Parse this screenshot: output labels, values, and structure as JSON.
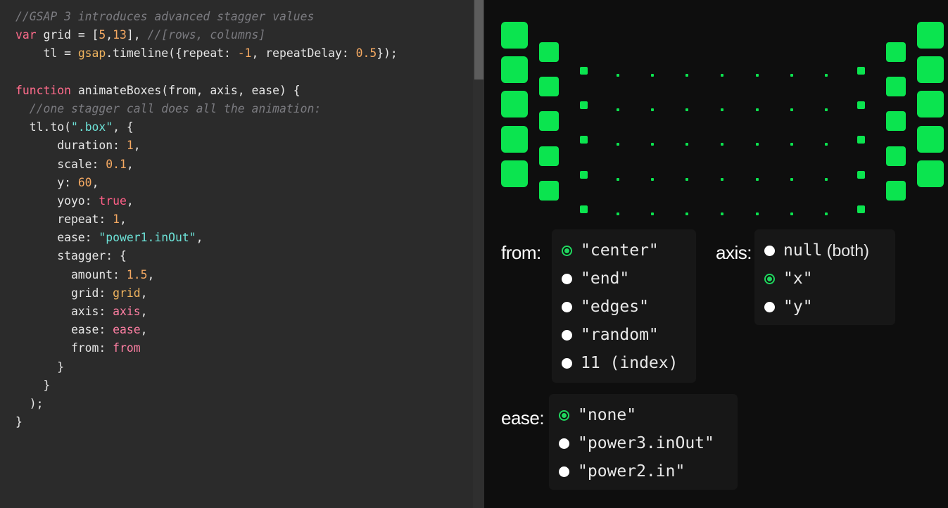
{
  "colors": {
    "editor_bg": "#2b2b2b",
    "demo_bg": "#0e0e0e",
    "box": "#0be44f",
    "radio_selected": "#20d85f"
  },
  "code": {
    "lines": [
      [
        {
          "t": "//GSAP 3 introduces advanced stagger values",
          "c": "cmt"
        }
      ],
      [
        {
          "t": "var",
          "c": "kw"
        },
        {
          "t": " grid = [",
          "c": "plain"
        },
        {
          "t": "5",
          "c": "num"
        },
        {
          "t": ",",
          "c": "plain"
        },
        {
          "t": "13",
          "c": "num"
        },
        {
          "t": "], ",
          "c": "plain"
        },
        {
          "t": "//[rows, columns]",
          "c": "cmt"
        }
      ],
      [
        {
          "t": "    tl = ",
          "c": "plain"
        },
        {
          "t": "gsap",
          "c": "fn"
        },
        {
          "t": ".timeline({repeat: ",
          "c": "plain"
        },
        {
          "t": "-1",
          "c": "num"
        },
        {
          "t": ", repeatDelay: ",
          "c": "plain"
        },
        {
          "t": "0.5",
          "c": "num"
        },
        {
          "t": "});",
          "c": "plain"
        }
      ],
      [],
      [
        {
          "t": "function",
          "c": "kw"
        },
        {
          "t": " animateBoxes(from, axis, ease) {",
          "c": "plain"
        }
      ],
      [
        {
          "t": "  //one stagger call does all the animation:",
          "c": "cmt"
        }
      ],
      [
        {
          "t": "  tl.to(",
          "c": "plain"
        },
        {
          "t": "\".box\"",
          "c": "str"
        },
        {
          "t": ", {",
          "c": "plain"
        }
      ],
      [
        {
          "t": "      duration: ",
          "c": "plain"
        },
        {
          "t": "1",
          "c": "num"
        },
        {
          "t": ",",
          "c": "plain"
        }
      ],
      [
        {
          "t": "      scale: ",
          "c": "plain"
        },
        {
          "t": "0.1",
          "c": "num"
        },
        {
          "t": ",",
          "c": "plain"
        }
      ],
      [
        {
          "t": "      y: ",
          "c": "plain"
        },
        {
          "t": "60",
          "c": "num"
        },
        {
          "t": ",",
          "c": "plain"
        }
      ],
      [
        {
          "t": "      yoyo: ",
          "c": "plain"
        },
        {
          "t": "true",
          "c": "bool"
        },
        {
          "t": ",",
          "c": "plain"
        }
      ],
      [
        {
          "t": "      repeat: ",
          "c": "plain"
        },
        {
          "t": "1",
          "c": "num"
        },
        {
          "t": ",",
          "c": "plain"
        }
      ],
      [
        {
          "t": "      ease: ",
          "c": "plain"
        },
        {
          "t": "\"power1.inOut\"",
          "c": "str"
        },
        {
          "t": ",",
          "c": "plain"
        }
      ],
      [
        {
          "t": "      stagger: {",
          "c": "plain"
        }
      ],
      [
        {
          "t": "        amount: ",
          "c": "plain"
        },
        {
          "t": "1.5",
          "c": "num"
        },
        {
          "t": ",",
          "c": "plain"
        }
      ],
      [
        {
          "t": "        grid: ",
          "c": "plain"
        },
        {
          "t": "grid",
          "c": "fn"
        },
        {
          "t": ",",
          "c": "plain"
        }
      ],
      [
        {
          "t": "        axis: ",
          "c": "plain"
        },
        {
          "t": "axis",
          "c": "var"
        },
        {
          "t": ",",
          "c": "plain"
        }
      ],
      [
        {
          "t": "        ease: ",
          "c": "plain"
        },
        {
          "t": "ease",
          "c": "var"
        },
        {
          "t": ",",
          "c": "plain"
        }
      ],
      [
        {
          "t": "        from: ",
          "c": "plain"
        },
        {
          "t": "from",
          "c": "var"
        }
      ],
      [
        {
          "t": "      }",
          "c": "plain"
        }
      ],
      [
        {
          "t": "    }",
          "c": "plain"
        }
      ],
      [
        {
          "t": "  );",
          "c": "plain"
        }
      ],
      [
        {
          "t": "}",
          "c": "plain"
        }
      ]
    ]
  },
  "controls": {
    "from": {
      "label": "from:",
      "options": [
        {
          "text": "\"center\"",
          "selected": true
        },
        {
          "text": "\"end\"",
          "selected": false
        },
        {
          "text": "\"edges\"",
          "selected": false
        },
        {
          "text": "\"random\"",
          "selected": false
        },
        {
          "text": "11 (index)",
          "selected": false
        }
      ]
    },
    "axis": {
      "label": "axis:",
      "options": [
        {
          "text": "null",
          "suffix": " (both)",
          "selected": false
        },
        {
          "text": "\"x\"",
          "selected": true
        },
        {
          "text": "\"y\"",
          "selected": false
        }
      ]
    },
    "ease": {
      "label": "ease:",
      "options": [
        {
          "text": "\"none\"",
          "selected": true
        },
        {
          "text": "\"power3.inOut\"",
          "selected": false
        },
        {
          "text": "\"power2.in\"",
          "selected": false
        }
      ]
    }
  }
}
